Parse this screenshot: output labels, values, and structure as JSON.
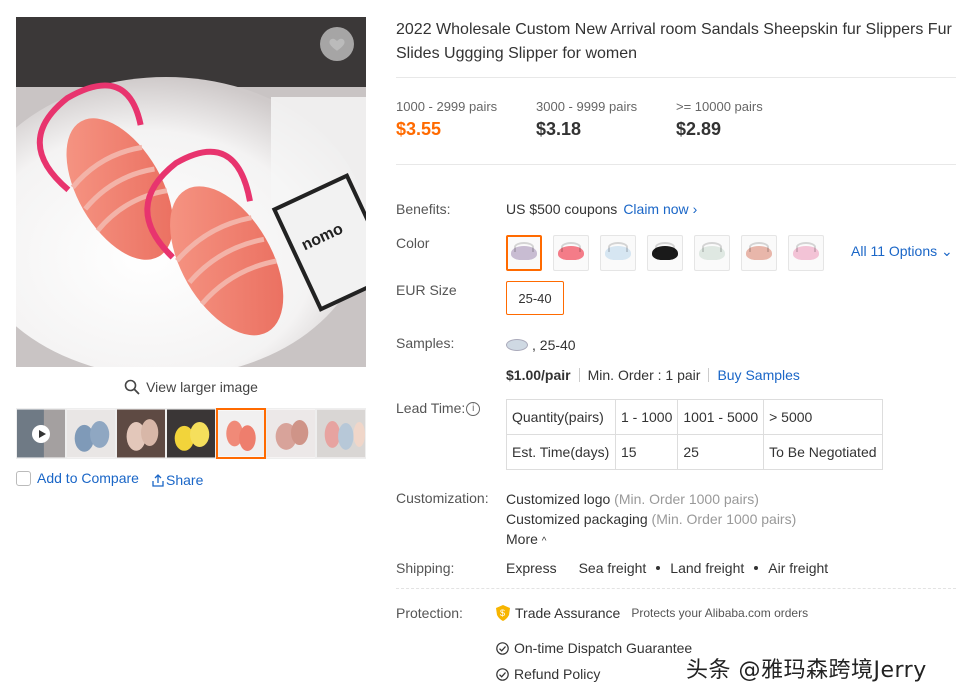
{
  "gallery": {
    "view_larger": "View larger image",
    "add_to_compare": "Add to Compare",
    "share": "Share",
    "main_box_text": "nomo"
  },
  "product": {
    "title": "2022 Wholesale Custom New Arrival room Sandals Sheepskin fur Slippers Fur Slides Uggging Slipper for women"
  },
  "price_tiers": [
    {
      "qty": "1000 - 2999 pairs",
      "price": "$3.55"
    },
    {
      "qty": "3000 - 9999 pairs",
      "price": "$3.18"
    },
    {
      "qty": ">= 10000 pairs",
      "price": "$2.89"
    }
  ],
  "benefits": {
    "label": "Benefits:",
    "text": "US $500 coupons",
    "claim": "Claim now"
  },
  "color": {
    "label": "Color",
    "all_options": "All 11 Options",
    "swatches": [
      "#c8bcd2",
      "#f47c88",
      "#d6e6f2",
      "#1a1a1a",
      "#dfe8e2",
      "#e8b6aa",
      "#f3c3d6"
    ]
  },
  "size": {
    "label": "EUR Size",
    "value": "25-40"
  },
  "samples": {
    "label": "Samples:",
    "variant": ", 25-40",
    "price": "$1.00/pair",
    "min_order": "Min. Order : 1 pair",
    "buy": "Buy Samples"
  },
  "lead_time": {
    "label": "Lead Time:",
    "info": "i",
    "rows": [
      [
        "Quantity(pairs)",
        "1 - 1000",
        "1001 - 5000",
        "> 5000"
      ],
      [
        "Est. Time(days)",
        "15",
        "25",
        "To Be Negotiated"
      ]
    ]
  },
  "customization": {
    "label": "Customization:",
    "items": [
      {
        "name": "Customized logo",
        "note": "(Min. Order 1000 pairs)"
      },
      {
        "name": "Customized packaging",
        "note": "(Min. Order 1000 pairs)"
      }
    ],
    "more": "More"
  },
  "shipping": {
    "label": "Shipping:",
    "methods": [
      "Express",
      "Sea freight",
      "Land freight",
      "Air freight"
    ]
  },
  "protection": {
    "label": "Protection:",
    "trade_assurance": "Trade Assurance",
    "trade_note": "Protects your Alibaba.com orders",
    "dispatch": "On-time Dispatch Guarantee",
    "refund": "Refund Policy"
  },
  "watermark": "头条 @雅玛森跨境Jerry",
  "colors": {
    "accent": "#ff6a00",
    "link": "#1a66c7"
  }
}
